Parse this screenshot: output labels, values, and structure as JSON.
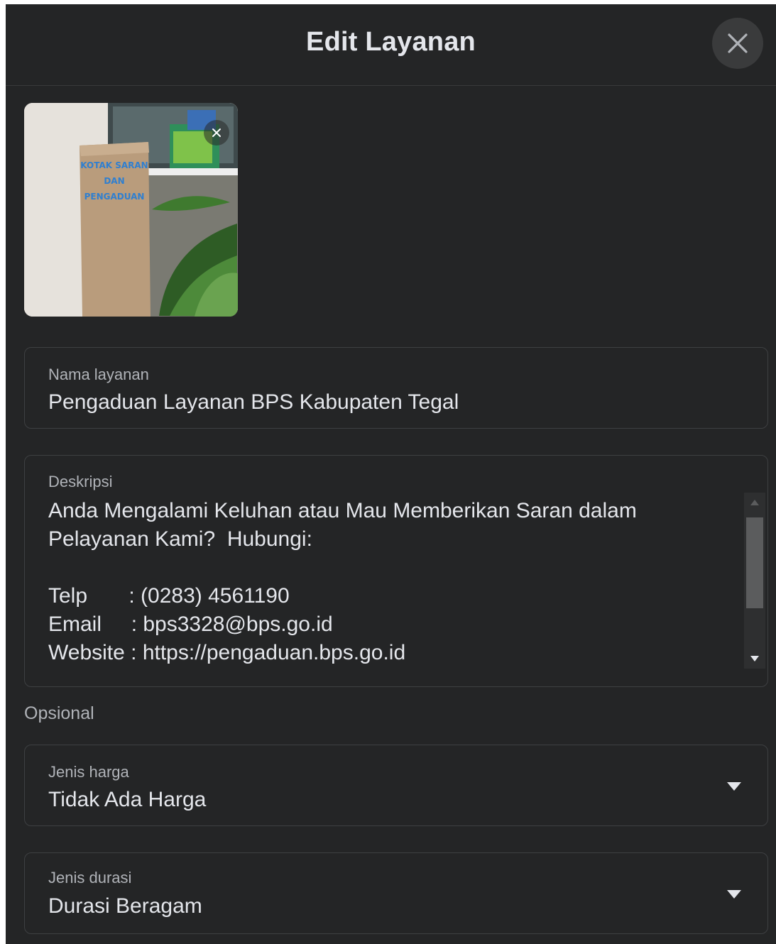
{
  "dialog": {
    "title": "Edit Layanan",
    "close_icon": "close-icon"
  },
  "image": {
    "box_text": "KOTAK SARAN DAN PENGADUAN",
    "remove_icon": "close-icon"
  },
  "name_field": {
    "label": "Nama layanan",
    "value": "Pengaduan Layanan BPS Kabupaten Tegal"
  },
  "description_field": {
    "label": "Deskripsi",
    "lines": [
      "Anda Mengalami Keluhan atau Mau Memberikan Saran dalam",
      "Pelayanan Kami?  Hubungi:",
      "",
      "Telp       : (0283) 4561190",
      "Email     : bps3328@bps.go.id",
      "Website : https://pengaduan.bps.go.id"
    ]
  },
  "optional_section": {
    "label": "Opsional"
  },
  "price_field": {
    "label": "Jenis harga",
    "value": "Tidak Ada Harga"
  },
  "duration_field": {
    "label": "Jenis durasi",
    "value": "Durasi Beragam"
  },
  "colors": {
    "background": "#242526",
    "border": "#3e4042",
    "text_primary": "#e4e6eb",
    "text_secondary": "#b0b3b8"
  }
}
